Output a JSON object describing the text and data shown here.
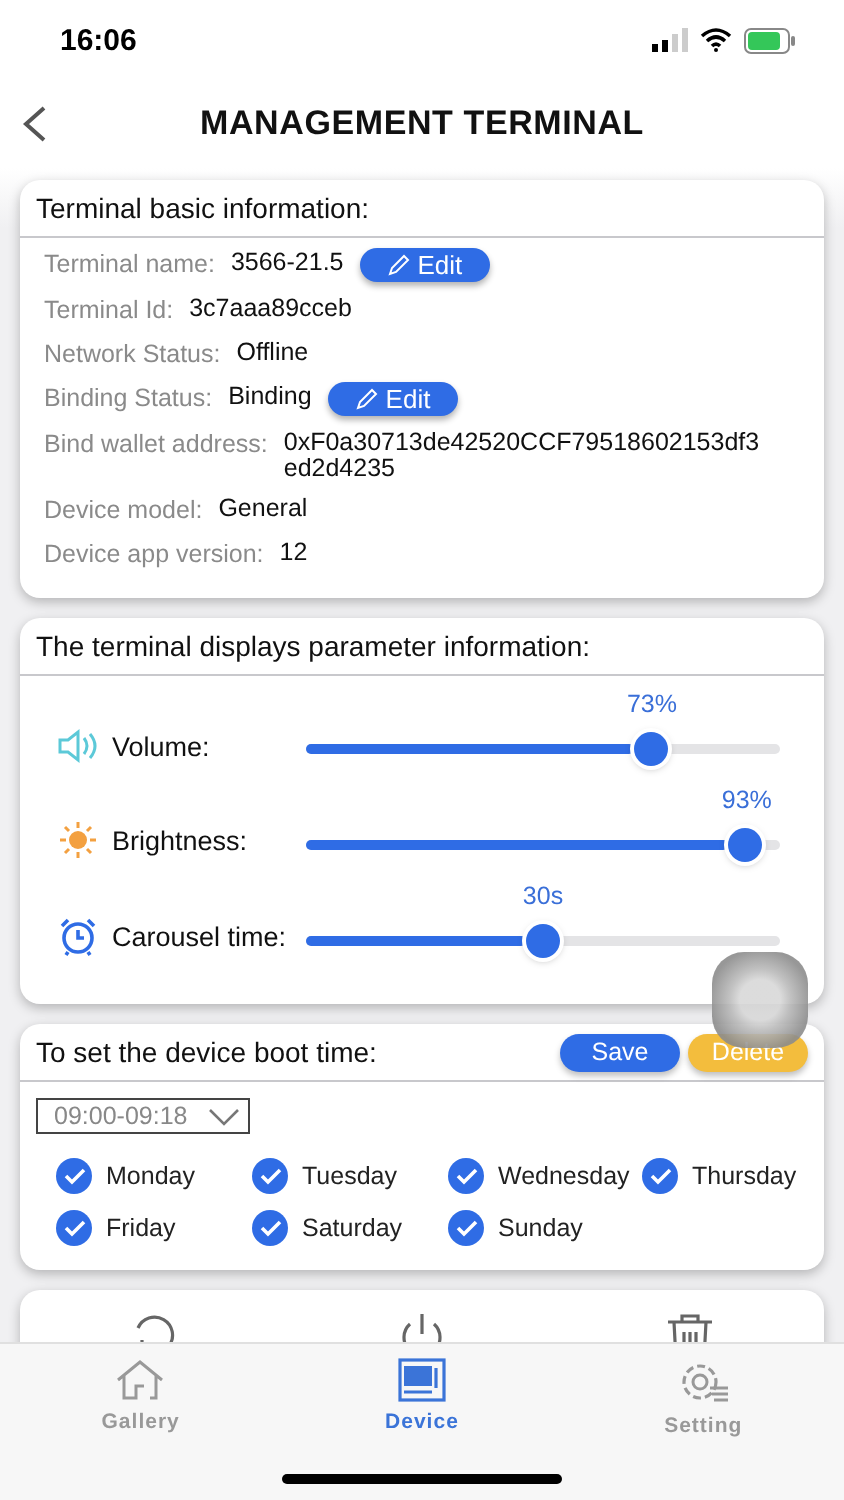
{
  "status_bar": {
    "time": "16:06"
  },
  "header": {
    "title": "MANAGEMENT TERMINAL"
  },
  "basic_info": {
    "title": "Terminal basic information:",
    "rows": [
      {
        "label": "Terminal name:",
        "value": "3566-21.5",
        "action": "Edit"
      },
      {
        "label": "Terminal Id:",
        "value": "3c7aaa89cceb"
      },
      {
        "label": "Network Status:",
        "value": "Offline"
      },
      {
        "label": "Binding Status:",
        "value": "Binding",
        "action": "Edit"
      },
      {
        "label": "Bind wallet address:",
        "value": "0xF0a30713de42520CCF79518602153df3ed2d4235"
      },
      {
        "label": "Device model:",
        "value": "General"
      },
      {
        "label": "Device app version:",
        "value": "12"
      }
    ]
  },
  "parameters": {
    "title": "The terminal displays parameter information:",
    "sliders": [
      {
        "kind": "volume",
        "label": "Volume:",
        "reading": "73%",
        "level": 0.73
      },
      {
        "kind": "brightness",
        "label": "Brightness:",
        "reading": "93%",
        "level": 0.93
      },
      {
        "kind": "clock",
        "label": "Carousel time:",
        "reading": "30s",
        "level": 0.5
      }
    ]
  },
  "boot_time": {
    "title": "To set the device boot time:",
    "buttons": [
      {
        "kind": "primary",
        "label": "Save"
      },
      {
        "kind": "warning",
        "label": "Delete"
      }
    ],
    "time_range": "09:00-09:18",
    "days": [
      {
        "label": "Monday",
        "checked": true
      },
      {
        "label": "Tuesday",
        "checked": true
      },
      {
        "label": "Wednesday",
        "checked": true
      },
      {
        "label": "Thursday",
        "checked": true
      },
      {
        "label": "Friday",
        "checked": true
      },
      {
        "label": "Saturday",
        "checked": true
      },
      {
        "label": "Sunday",
        "checked": true
      }
    ]
  },
  "tabs": [
    {
      "kind": "home",
      "label": "Gallery",
      "selected": false
    },
    {
      "kind": "device",
      "label": "Device",
      "selected": true
    },
    {
      "kind": "gear",
      "label": "Setting",
      "selected": false
    }
  ]
}
